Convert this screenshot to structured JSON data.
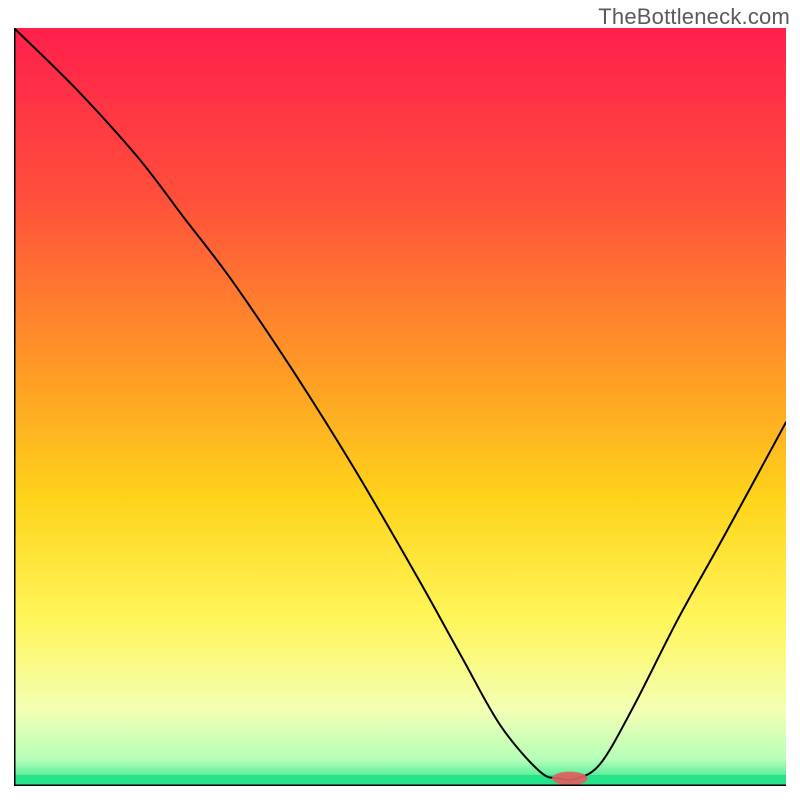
{
  "watermark": "TheBottleneck.com",
  "chart_data": {
    "type": "line",
    "title": "",
    "xlabel": "",
    "ylabel": "",
    "xlim": [
      0,
      100
    ],
    "ylim": [
      0,
      100
    ],
    "grid": false,
    "legend": false,
    "annotations": [],
    "background_gradient": {
      "stops": [
        {
          "pos": 0.0,
          "color": "#ff1f4c"
        },
        {
          "pos": 0.22,
          "color": "#ff4e3b"
        },
        {
          "pos": 0.45,
          "color": "#ff9a26"
        },
        {
          "pos": 0.62,
          "color": "#ffd31a"
        },
        {
          "pos": 0.78,
          "color": "#fff65a"
        },
        {
          "pos": 0.9,
          "color": "#f4ffb4"
        },
        {
          "pos": 0.965,
          "color": "#b5ffb8"
        },
        {
          "pos": 1.0,
          "color": "#24e38a"
        }
      ]
    },
    "series": [
      {
        "name": "curve",
        "x": [
          0.0,
          8.0,
          16.0,
          22.0,
          28.0,
          36.0,
          44.0,
          52.0,
          58.0,
          63.0,
          68.0,
          70.5,
          73.0,
          76.0,
          80.0,
          86.0,
          92.0,
          100.0
        ],
        "y": [
          100.0,
          92.0,
          83.0,
          75.0,
          67.0,
          55.0,
          42.0,
          28.0,
          17.0,
          8.0,
          2.0,
          1.0,
          1.0,
          3.0,
          10.0,
          22.0,
          33.0,
          48.0
        ]
      }
    ],
    "marker": {
      "x": 72.0,
      "y": 1.0,
      "rx": 2.3,
      "ry": 0.9,
      "color": "#e06060"
    }
  }
}
